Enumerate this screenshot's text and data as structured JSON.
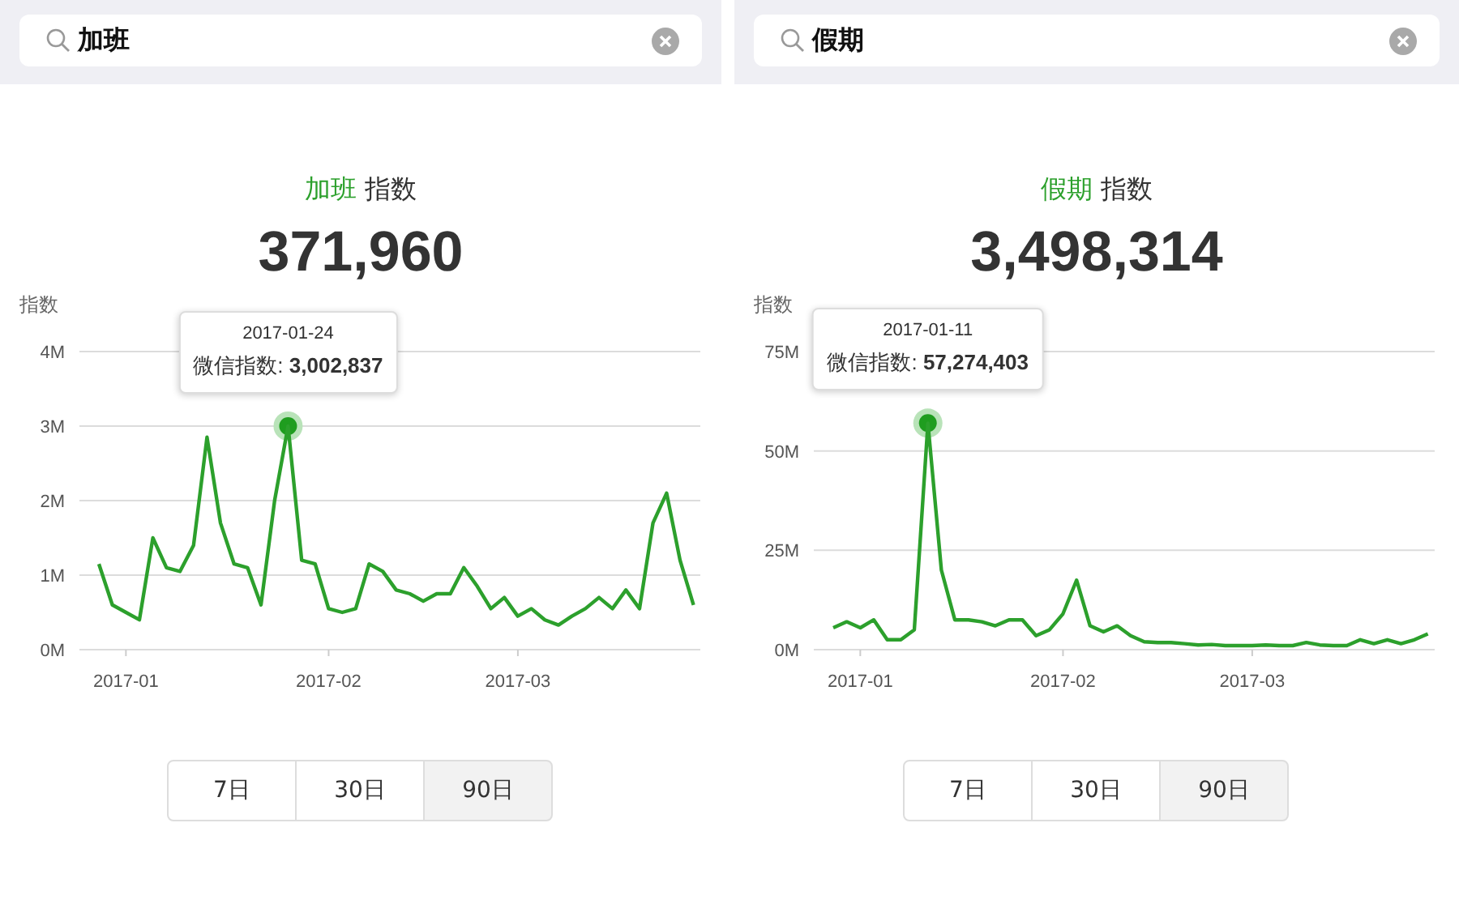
{
  "panels": [
    {
      "search": {
        "value": "加班"
      },
      "title_keyword": "加班",
      "title_suffix": "指数",
      "total": "371,960",
      "chart_data": {
        "type": "line",
        "ylabel": "指数",
        "ylim": [
          0,
          4
        ],
        "categories": [
          null,
          null,
          "2017-01",
          null,
          null,
          null,
          null,
          null,
          null,
          null,
          null,
          null,
          null,
          null,
          null,
          null,
          null,
          "2017-02",
          null,
          null,
          null,
          null,
          null,
          null,
          null,
          null,
          null,
          null,
          null,
          null,
          null,
          "2017-03",
          null,
          null,
          null,
          null,
          null,
          null,
          null,
          null,
          null,
          null,
          null,
          null,
          null
        ],
        "series": [
          {
            "color": "#2ca02c",
            "values": [
              1.15,
              0.6,
              0.5,
              0.4,
              1.5,
              1.1,
              1.05,
              1.4,
              2.85,
              1.7,
              1.15,
              1.1,
              0.6,
              2.0,
              3.0,
              1.2,
              1.15,
              0.55,
              0.5,
              0.55,
              1.15,
              1.05,
              0.8,
              0.75,
              0.65,
              0.75,
              0.75,
              1.1,
              0.85,
              0.55,
              0.7,
              0.45,
              0.55,
              0.4,
              0.33,
              0.45,
              0.55,
              0.7,
              0.55,
              0.8,
              0.55,
              1.7,
              2.1,
              1.2,
              0.6
            ]
          }
        ],
        "yticks": [
          {
            "value": 0,
            "label": "0M"
          },
          {
            "value": 1,
            "label": "1M"
          },
          {
            "value": 2,
            "label": "2M"
          },
          {
            "value": 3,
            "label": "3M"
          },
          {
            "value": 4,
            "label": "4M"
          }
        ],
        "grid": true
      },
      "tooltip": {
        "date": "2017-01-24",
        "text": "微信指数: **3,002,837**"
      },
      "ranges": [
        {
          "label": "7日",
          "selected": false
        },
        {
          "label": "30日",
          "selected": false
        },
        {
          "label": "90日",
          "selected": true
        }
      ]
    },
    {
      "search": {
        "value": "假期"
      },
      "title_keyword": "假期",
      "title_suffix": "指数",
      "total": "3,498,314",
      "chart_data": {
        "type": "line",
        "ylabel": "指数",
        "ylim": [
          0,
          75
        ],
        "categories": [
          null,
          null,
          "2017-01",
          null,
          null,
          null,
          null,
          null,
          null,
          null,
          null,
          null,
          null,
          null,
          null,
          null,
          null,
          "2017-02",
          null,
          null,
          null,
          null,
          null,
          null,
          null,
          null,
          null,
          null,
          null,
          null,
          null,
          "2017-03",
          null,
          null,
          null,
          null,
          null,
          null,
          null,
          null,
          null,
          null,
          null,
          null,
          null
        ],
        "series": [
          {
            "color": "#2ca02c",
            "values": [
              5.5,
              7,
              5.5,
              7.5,
              2.5,
              2.5,
              5,
              57,
              20,
              7.5,
              7.5,
              7,
              6,
              7.5,
              7.5,
              3.5,
              5,
              9,
              17.5,
              6,
              4.5,
              6,
              3.5,
              2,
              1.8,
              1.8,
              1.5,
              1.2,
              1.3,
              1,
              1,
              1,
              1.2,
              1,
              1,
              1.8,
              1.2,
              1,
              1,
              2.5,
              1.5,
              2.5,
              1.5,
              2.5,
              4
            ]
          }
        ],
        "yticks": [
          {
            "value": 0,
            "label": "0M"
          },
          {
            "value": 25,
            "label": "25M"
          },
          {
            "value": 50,
            "label": "50M"
          },
          {
            "value": 75,
            "label": "75M"
          }
        ],
        "grid": true
      },
      "tooltip": {
        "date": "2017-01-11",
        "text": "微信指数: **57,274,403**"
      },
      "ranges": [
        {
          "label": "7日",
          "selected": false
        },
        {
          "label": "30日",
          "selected": false
        },
        {
          "label": "90日",
          "selected": true
        }
      ]
    }
  ]
}
